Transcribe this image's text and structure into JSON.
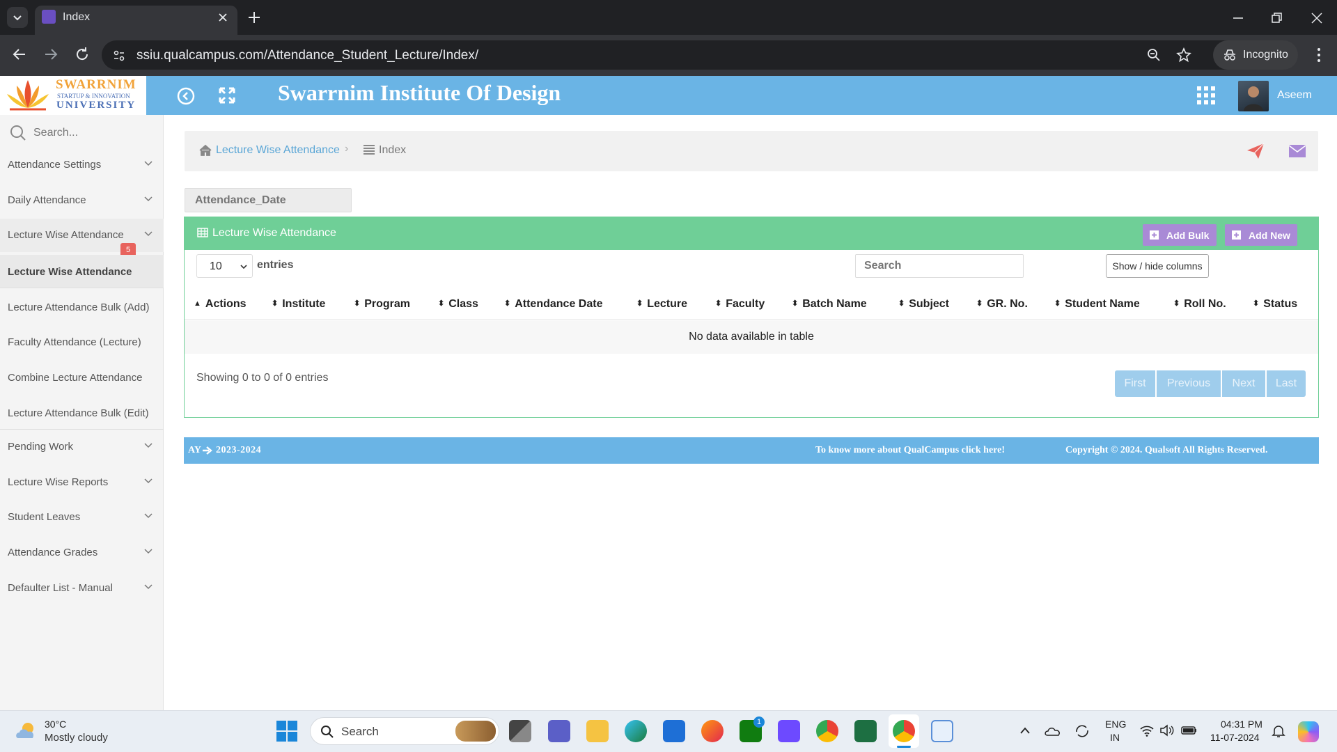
{
  "browser": {
    "tab_title": "Index",
    "url": "ssiu.qualcampus.com/Attendance_Student_Lecture/Index/",
    "incognito_label": "Incognito"
  },
  "header": {
    "logo_line1": "SWARRNIM",
    "logo_line2": "STARTUP & INNOVATION",
    "logo_line3": "UNIVERSITY",
    "title": "Swarrnim Institute Of Design",
    "user_name": "Aseem"
  },
  "sidebar": {
    "search_placeholder": "Search...",
    "items": [
      {
        "label": "Attendance Settings"
      },
      {
        "label": "Daily Attendance"
      },
      {
        "label": "Lecture Wise Attendance",
        "badge": "5"
      },
      {
        "label": "Pending Work"
      },
      {
        "label": "Lecture Wise Reports"
      },
      {
        "label": "Student Leaves"
      },
      {
        "label": "Attendance Grades"
      },
      {
        "label": "Defaulter List - Manual"
      }
    ],
    "subitems": [
      {
        "label": "Lecture Wise Attendance"
      },
      {
        "label": "Lecture Attendance Bulk (Add)"
      },
      {
        "label": "Faculty Attendance (Lecture)"
      },
      {
        "label": "Combine Lecture Attendance"
      },
      {
        "label": "Lecture Attendance Bulk (Edit)"
      }
    ]
  },
  "breadcrumb": {
    "parent": "Lecture Wise Attendance",
    "current": "Index"
  },
  "filter": {
    "date_placeholder": "Attendance_Date"
  },
  "card": {
    "title": "Lecture Wise Attendance",
    "add_bulk_label": "Add Bulk",
    "add_new_label": "Add New",
    "page_size": "10",
    "entries_label": "entries",
    "search_placeholder": "Search",
    "show_hide_label": "Show / hide columns",
    "columns": [
      "Actions",
      "Institute",
      "Program",
      "Class",
      "Attendance Date",
      "Lecture",
      "Faculty",
      "Batch Name",
      "Subject",
      "GR. No.",
      "Student Name",
      "Roll No.",
      "Status"
    ],
    "empty_message": "No data available in table",
    "info": "Showing 0 to 0 of 0 entries",
    "pagination": [
      "First",
      "Previous",
      "Next",
      "Last"
    ]
  },
  "footer": {
    "ay_label": "AY",
    "ay_value": "2023-2024",
    "info_link": "To know more about QualCampus click here!",
    "copyright": "Copyright © 2024. Qualsoft All Rights Reserved."
  },
  "taskbar": {
    "temperature": "30°C",
    "weather": "Mostly cloudy",
    "search_label": "Search",
    "lang_line1": "ENG",
    "lang_line2": "IN",
    "time": "04:31 PM",
    "date": "11-07-2024",
    "teams_badge": "1"
  },
  "colors": {
    "header_blue": "#6ab4e5",
    "card_green": "#6fcf97",
    "button_purple": "#a98ad6",
    "badge_red": "#e8635d"
  }
}
